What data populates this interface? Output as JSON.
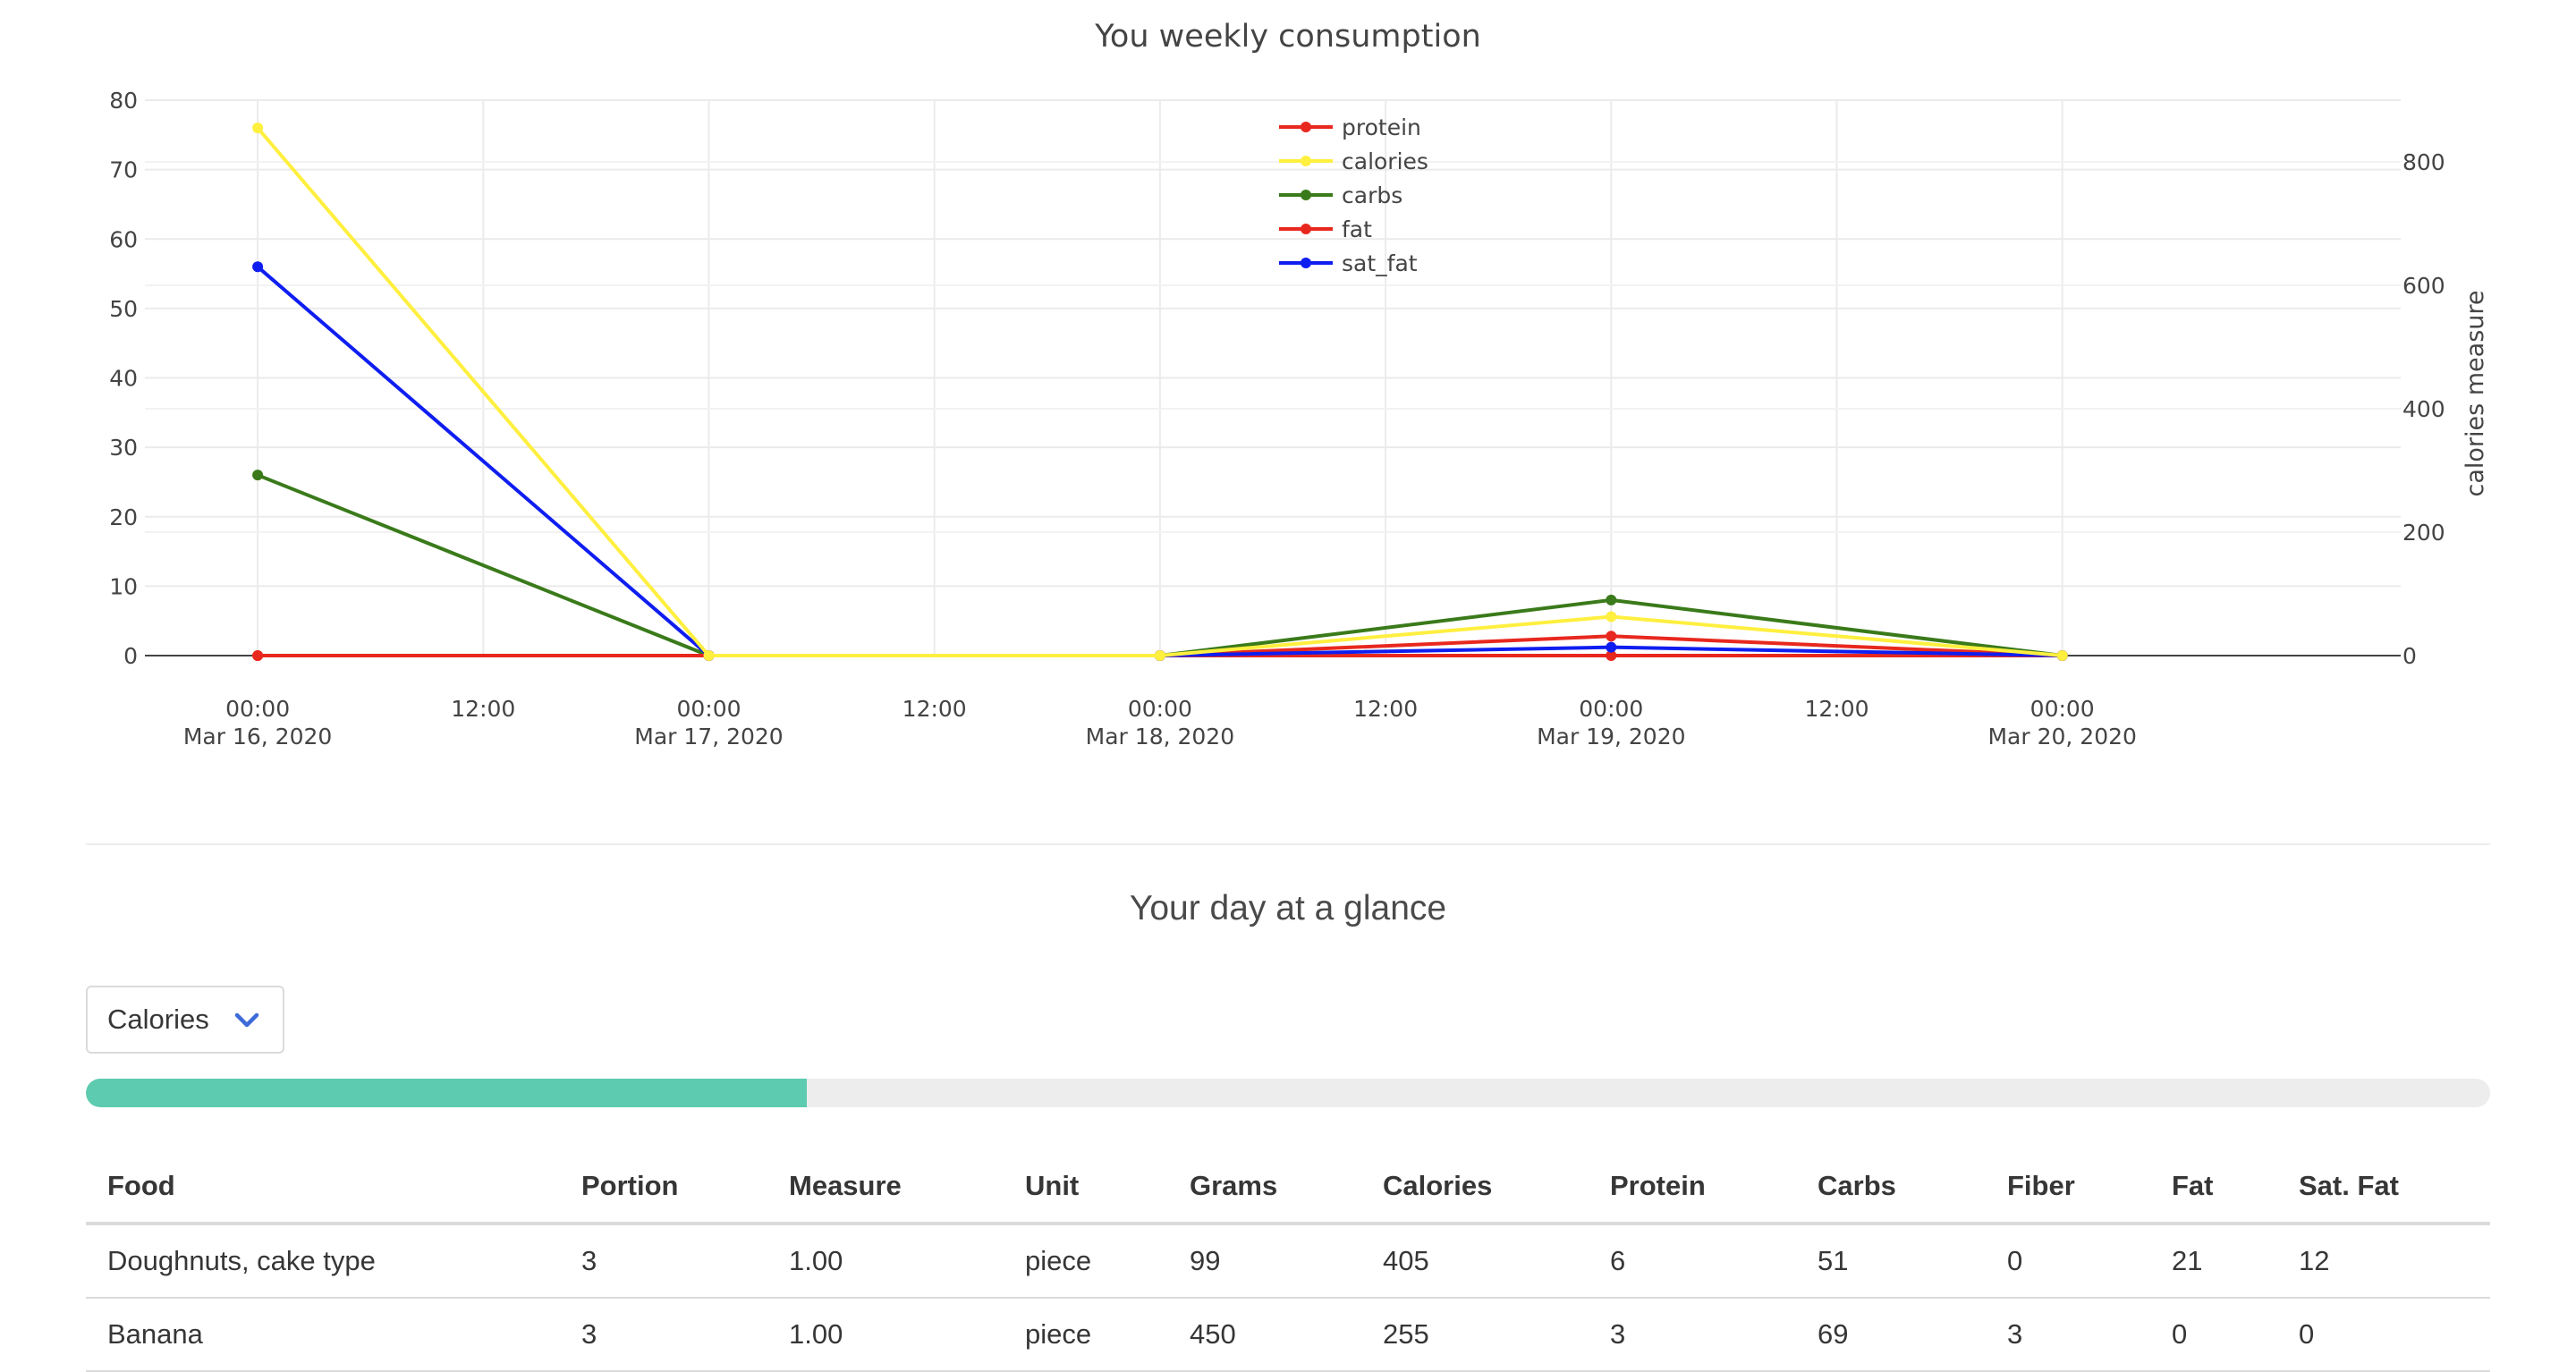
{
  "chart": {
    "title": "You weekly consumption",
    "y2label": "calories measure"
  },
  "chart_data": {
    "type": "line",
    "title": "You weekly consumption",
    "xlabel": "",
    "ylabel": "",
    "y2label": "calories measure",
    "x": [
      "2020-03-16",
      "2020-03-17",
      "2020-03-18",
      "2020-03-19",
      "2020-03-20"
    ],
    "xlim": [
      "2020-03-15 18:00",
      "2020-03-20 18:00"
    ],
    "x_ticks": [
      {
        "time": "00:00",
        "date": "Mar 16, 2020",
        "at": "2020-03-16 00:00"
      },
      {
        "time": "12:00",
        "date": "",
        "at": "2020-03-16 12:00"
      },
      {
        "time": "00:00",
        "date": "Mar 17, 2020",
        "at": "2020-03-17 00:00"
      },
      {
        "time": "12:00",
        "date": "",
        "at": "2020-03-17 12:00"
      },
      {
        "time": "00:00",
        "date": "Mar 18, 2020",
        "at": "2020-03-18 00:00"
      },
      {
        "time": "12:00",
        "date": "",
        "at": "2020-03-18 12:00"
      },
      {
        "time": "00:00",
        "date": "Mar 19, 2020",
        "at": "2020-03-19 00:00"
      },
      {
        "time": "12:00",
        "date": "",
        "at": "2020-03-19 12:00"
      },
      {
        "time": "00:00",
        "date": "Mar 20, 2020",
        "at": "2020-03-20 00:00"
      }
    ],
    "ylim": [
      0,
      80
    ],
    "y_ticks": [
      0,
      10,
      20,
      30,
      40,
      50,
      60,
      70,
      80
    ],
    "y2lim": [
      0,
      900
    ],
    "y2_ticks": [
      0,
      200,
      400,
      600,
      800
    ],
    "grid": true,
    "legend": "top-center",
    "series": [
      {
        "name": "protein",
        "axis": "y",
        "color": "#e8281e",
        "values": [
          0,
          0,
          0,
          0,
          0
        ]
      },
      {
        "name": "calories",
        "axis": "y2",
        "color": "#ffef3f",
        "values": [
          855,
          0,
          0,
          63,
          0
        ]
      },
      {
        "name": "carbs",
        "axis": "y",
        "color": "#3a7a1a",
        "values": [
          26,
          0,
          0,
          8,
          0
        ]
      },
      {
        "name": "fat",
        "axis": "y",
        "color": "#e8281e",
        "values": [
          0,
          0,
          0,
          2.8,
          0
        ]
      },
      {
        "name": "sat_fat",
        "axis": "y",
        "color": "#0f1ef0",
        "values": [
          56,
          0,
          0,
          1.2,
          0
        ]
      }
    ]
  },
  "glance": {
    "title": "Your day at a glance",
    "select_value": "Calories",
    "chevron_icon": "chevron-down-icon",
    "progress": 0.3,
    "progress_color": "#5ccbaf"
  },
  "table": {
    "headers": [
      "Food",
      "Portion",
      "Measure",
      "Unit",
      "Grams",
      "Calories",
      "Protein",
      "Carbs",
      "Fiber",
      "Fat",
      "Sat. Fat"
    ],
    "rows": [
      [
        "Doughnuts, cake type",
        "3",
        "1.00",
        "piece",
        "99",
        "405",
        "6",
        "51",
        "0",
        "21",
        "12"
      ],
      [
        "Banana",
        "3",
        "1.00",
        "piece",
        "450",
        "255",
        "3",
        "69",
        "3",
        "0",
        "0"
      ]
    ]
  }
}
